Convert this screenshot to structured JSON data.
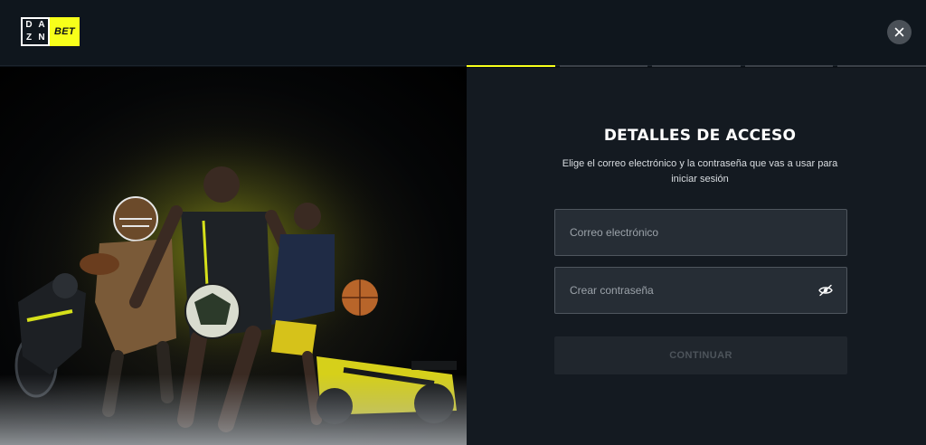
{
  "brand": {
    "logo_letters": [
      "DA",
      "ZN"
    ],
    "logo_suffix": "BET",
    "accent_color": "#f7ff1a"
  },
  "header": {
    "close_icon": "close-icon"
  },
  "progress": {
    "total_steps": 5,
    "current_step": 1
  },
  "form": {
    "title": "DETALLES DE ACCESO",
    "subtitle": "Elige el correo electrónico y la contraseña que vas a usar para iniciar sesión",
    "email_placeholder": "Correo electrónico",
    "email_value": "",
    "password_placeholder": "Crear contraseña",
    "password_value": "",
    "password_toggle_icon": "eye-icon",
    "continue_label": "CONTINUAR",
    "continue_disabled": true
  }
}
